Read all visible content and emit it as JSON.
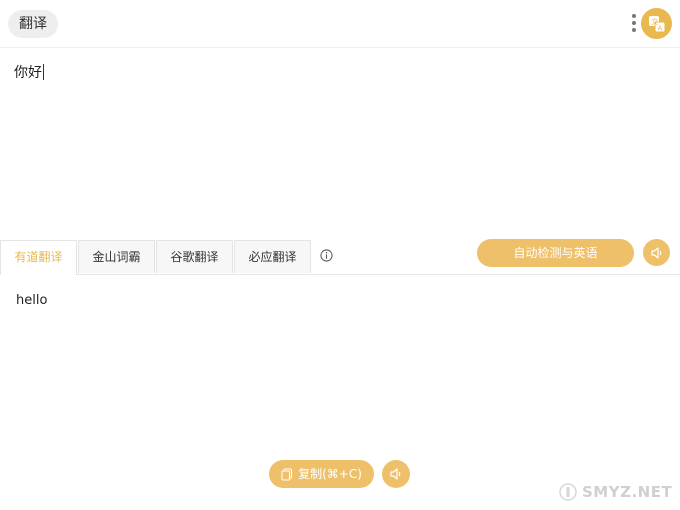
{
  "header": {
    "title": "翻译"
  },
  "icons": {
    "more": "more-vertical-icon",
    "app": "translate-app-icon",
    "info": "info-icon",
    "speaker": "speaker-icon",
    "copy": "copy-icon"
  },
  "source": {
    "text": "你好"
  },
  "tabs": [
    {
      "label": "有道翻译",
      "active": true
    },
    {
      "label": "金山词霸",
      "active": false
    },
    {
      "label": "谷歌翻译",
      "active": false
    },
    {
      "label": "必应翻译",
      "active": false
    }
  ],
  "language_button": "自动检测与英语",
  "result": {
    "text": "hello"
  },
  "copy_button": "复制(⌘+C)",
  "watermark": "SMYZ.NET",
  "colors": {
    "accent": "#e9b84e",
    "button": "#eec06a"
  }
}
